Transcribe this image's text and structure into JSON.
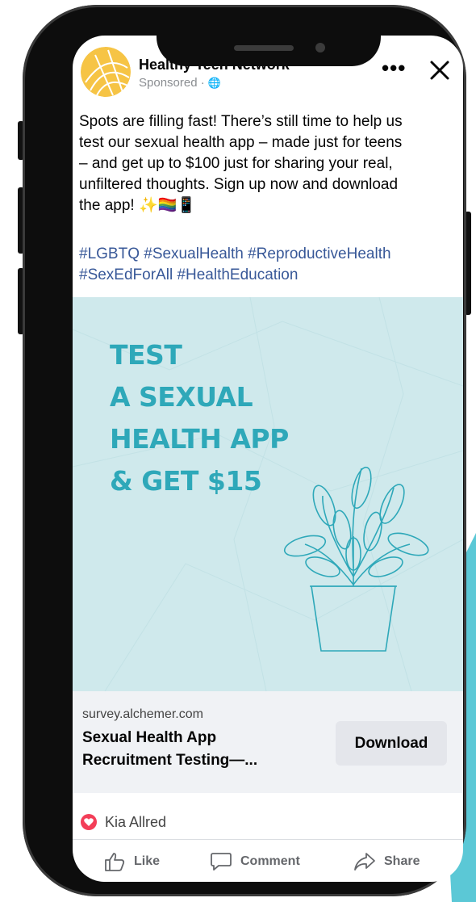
{
  "post": {
    "page_name": "Healthy Teen Network",
    "sponsored_label": "Sponsored · ",
    "globe_icon": "globe-icon",
    "body_text": "Spots are filling fast! There’s still time to help us\ntest our sexual health app – made just for teens\n– and get up to $100 just for sharing your real,\nunfiltered thoughts. Sign up now and download\nthe app! ✨🏳️‍🌈📱",
    "hashtags": "#LGBTQ #SexualHealth #ReproductiveHealth\n#SexEdForAll #HealthEducation"
  },
  "creative": {
    "lines": [
      "TEST",
      "A SEXUAL",
      "HEALTH APP",
      "& GET $15"
    ],
    "text_color": "#2ea8b9",
    "background": "#cfe9ec"
  },
  "link": {
    "domain": "survey.alchemer.com",
    "title": "Sexual Health App\nRecruitment Testing—...",
    "cta_label": "Download"
  },
  "reactions": {
    "reactor_name": "Kia Allred"
  },
  "actions": {
    "like_label": "Like",
    "comment_label": "Comment",
    "share_label": "Share"
  },
  "colors": {
    "link_blue": "#385898",
    "heart_red": "#f33e58",
    "teal_accent": "#5bc8d6"
  }
}
